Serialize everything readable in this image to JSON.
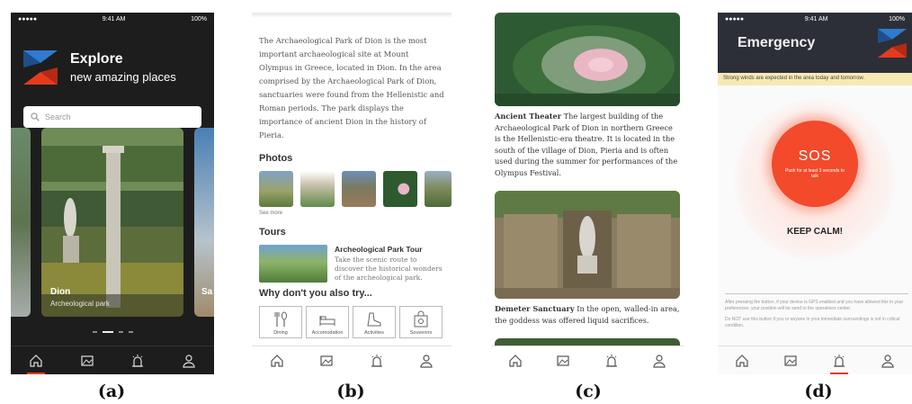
{
  "screen_a": {
    "status": {
      "carrier": "●●●●●",
      "time": "9:41 AM",
      "battery": "100%"
    },
    "title": "Explore",
    "subtitle": "new amazing places",
    "search_placeholder": "Search",
    "cards": [
      {
        "name": "Dion",
        "subtitle": "Archeological park"
      },
      {
        "name": "Sa",
        "subtitle": ""
      }
    ],
    "tabs": [
      "home-icon",
      "map-icon",
      "emergency-icon",
      "profile-icon"
    ],
    "active_tab": 0
  },
  "screen_b": {
    "intro": "The Archaeological Park of Dion is the most important archaeological site at Mount Olympus in Greece, located in Dion. In the area comprised by the Archaeological Park of Dion, sanctuaries were found from the Hellenistic and Roman periods. The park displays the importance of ancient Dion in the history of Pieria.",
    "photos_heading": "Photos",
    "see_more": "See more",
    "tours_heading": "Tours",
    "tour_title": "Archeological Park Tour",
    "tour_desc": "Take the scenic route to discover the historical wonders of the archeological park.",
    "try_heading": "Why don't you also try...",
    "try_items": [
      "Dining",
      "Accomodation",
      "Activities",
      "Souvenirs"
    ],
    "tabs": [
      "home-icon",
      "map-icon",
      "emergency-icon",
      "profile-icon"
    ]
  },
  "screen_c": {
    "entry1_title": "Ancient Theater",
    "entry1_text": " The largest building of the Archaeological Park of Dion in northern Greece is the Hellenistic-era theatre. It is located in the south of the village of Dion, Pieria and is often used during the summer for performances of the Olympus Festival.",
    "entry2_title": "Demeter Sanctuary",
    "entry2_text": " In the open, walled-in area, the goddess was offered liquid sacrifices.",
    "tabs": [
      "home-icon",
      "map-icon",
      "emergency-icon",
      "profile-icon"
    ]
  },
  "screen_d": {
    "status": {
      "carrier": "●●●●●",
      "time": "9:41 AM",
      "battery": "100%"
    },
    "title": "Emergency",
    "warning": "Strong winds are expected in the area today and tomorrow.",
    "sos_title": "SOS",
    "sos_sub": "Push for at least 3 seconds to talk",
    "calm": "KEEP CALM!",
    "note1": "After pressing the button, if your device is GPS enabled and you have allowed this in your preferences, your position will be send to the operations center.",
    "note2": "Do NOT use this button if you or anyone in your immediate surroundings is not in critical condition.",
    "tabs": [
      "home-icon",
      "map-icon",
      "emergency-icon",
      "profile-icon"
    ],
    "active_tab": 2
  },
  "captions": [
    "(a)",
    "(b)",
    "(c)",
    "(d)"
  ],
  "colors": {
    "accent": "#e63a1f",
    "dark_bg": "#1d1d1d",
    "emergency_header": "#2c2f38",
    "warning_bg": "#f7e9b6",
    "sos_red": "#f24a2b"
  }
}
